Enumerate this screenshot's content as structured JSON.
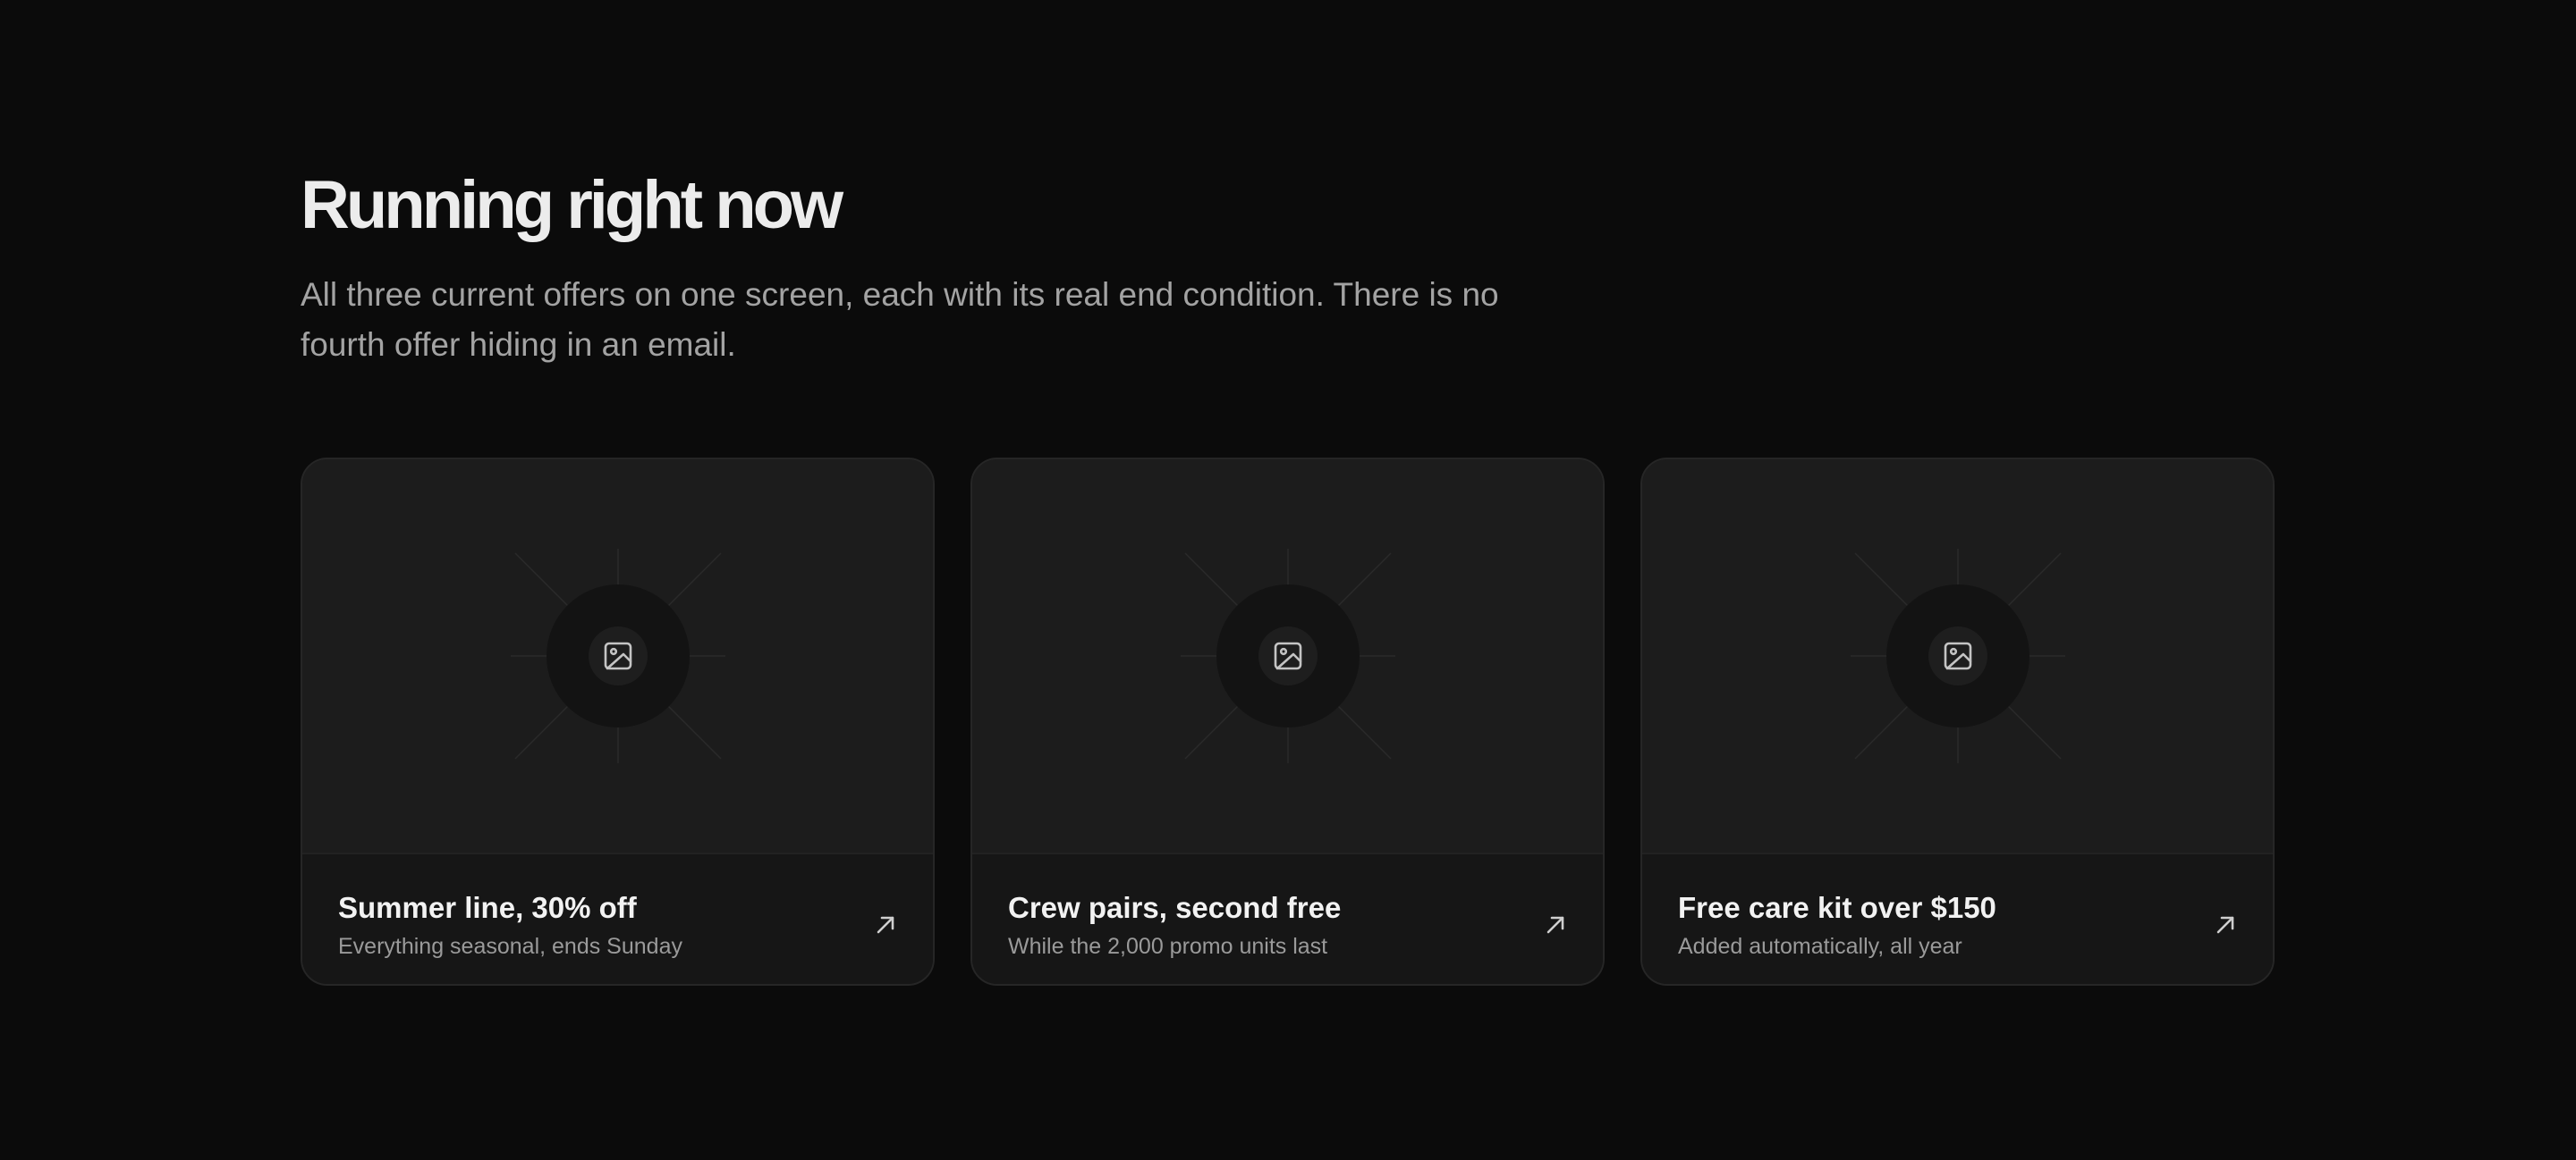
{
  "header": {
    "title": "Running right now",
    "subtitle": "All three current offers on one screen, each with its real end condition. There is no fourth offer hiding in an email."
  },
  "offers": [
    {
      "title": "Summer line, 30% off",
      "caption": "Everything seasonal, ends Sunday",
      "media_icon": "image-placeholder-icon",
      "action_icon": "arrow-up-right-icon"
    },
    {
      "title": "Crew pairs, second free",
      "caption": "While the 2,000 promo units last",
      "media_icon": "image-placeholder-icon",
      "action_icon": "arrow-up-right-icon"
    },
    {
      "title": "Free care kit over $150",
      "caption": "Added automatically, all year",
      "media_icon": "image-placeholder-icon",
      "action_icon": "arrow-up-right-icon"
    }
  ],
  "colors": {
    "background": "#0b0b0b",
    "card_media": "#1c1c1c",
    "card_footer": "#161616",
    "title_text": "#ececec",
    "muted_text": "#a3a3a3"
  }
}
